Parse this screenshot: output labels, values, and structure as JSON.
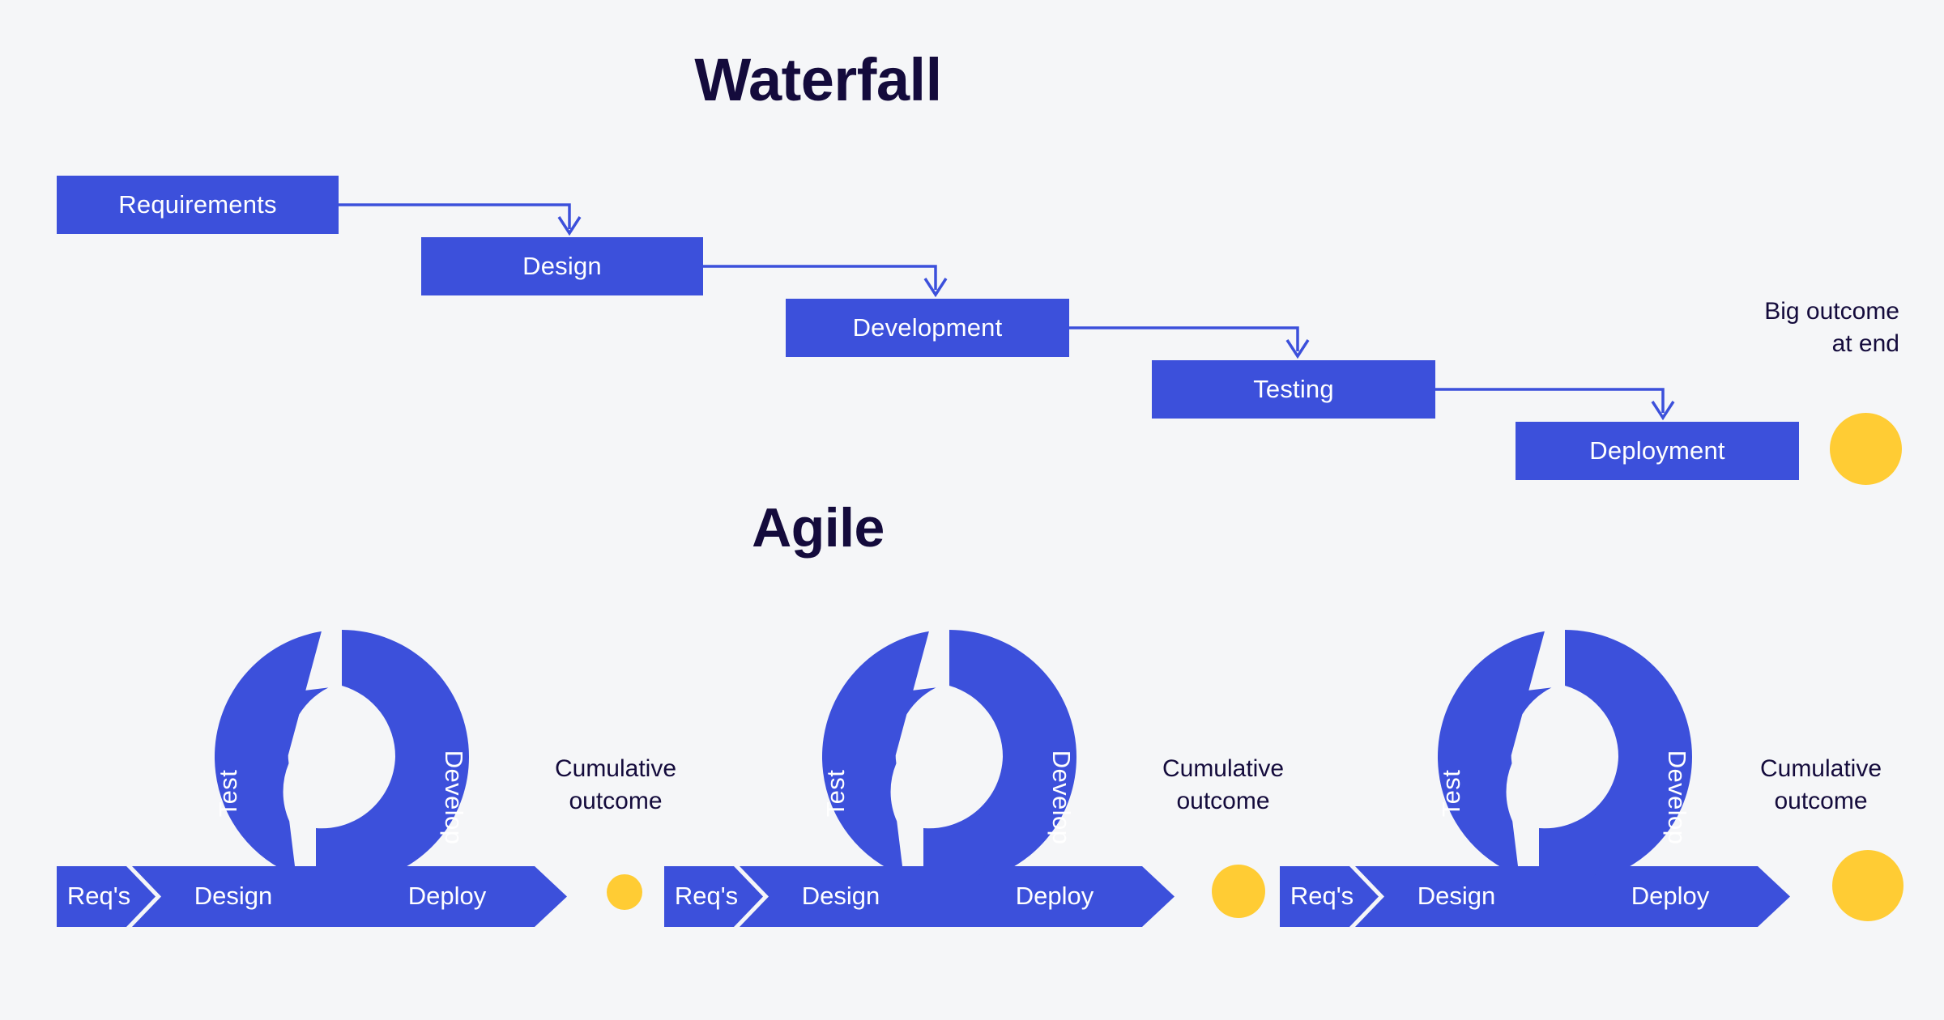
{
  "page": {
    "background_color": "#f5f6f8",
    "primary_blue": "#3c50db",
    "accent_yellow": "#ffcc34",
    "dark_navy": "#140b3c"
  },
  "waterfall": {
    "title": "Waterfall",
    "annotation": "Big outcome\nat end",
    "stages": [
      {
        "label": "Requirements"
      },
      {
        "label": "Design"
      },
      {
        "label": "Development"
      },
      {
        "label": "Testing"
      },
      {
        "label": "Deployment"
      }
    ],
    "outcome_dot": {
      "size": 89
    }
  },
  "agile": {
    "title": "Agile",
    "sprints": [
      {
        "ring": {
          "test": "Test",
          "develop": "Develop"
        },
        "chevrons": [
          {
            "label": "Req's"
          },
          {
            "label": "Design"
          },
          {
            "label": "Deploy"
          }
        ],
        "annotation": "Cumulative\noutcome",
        "outcome_dot": {
          "size": 44
        }
      },
      {
        "ring": {
          "test": "Test",
          "develop": "Develop"
        },
        "chevrons": [
          {
            "label": "Req's"
          },
          {
            "label": "Design"
          },
          {
            "label": "Deploy"
          }
        ],
        "annotation": "Cumulative\noutcome",
        "outcome_dot": {
          "size": 66
        }
      },
      {
        "ring": {
          "test": "Test",
          "develop": "Develop"
        },
        "chevrons": [
          {
            "label": "Req's"
          },
          {
            "label": "Design"
          },
          {
            "label": "Deploy"
          }
        ],
        "annotation": "Cumulative\noutcome",
        "outcome_dot": {
          "size": 88
        }
      }
    ]
  }
}
